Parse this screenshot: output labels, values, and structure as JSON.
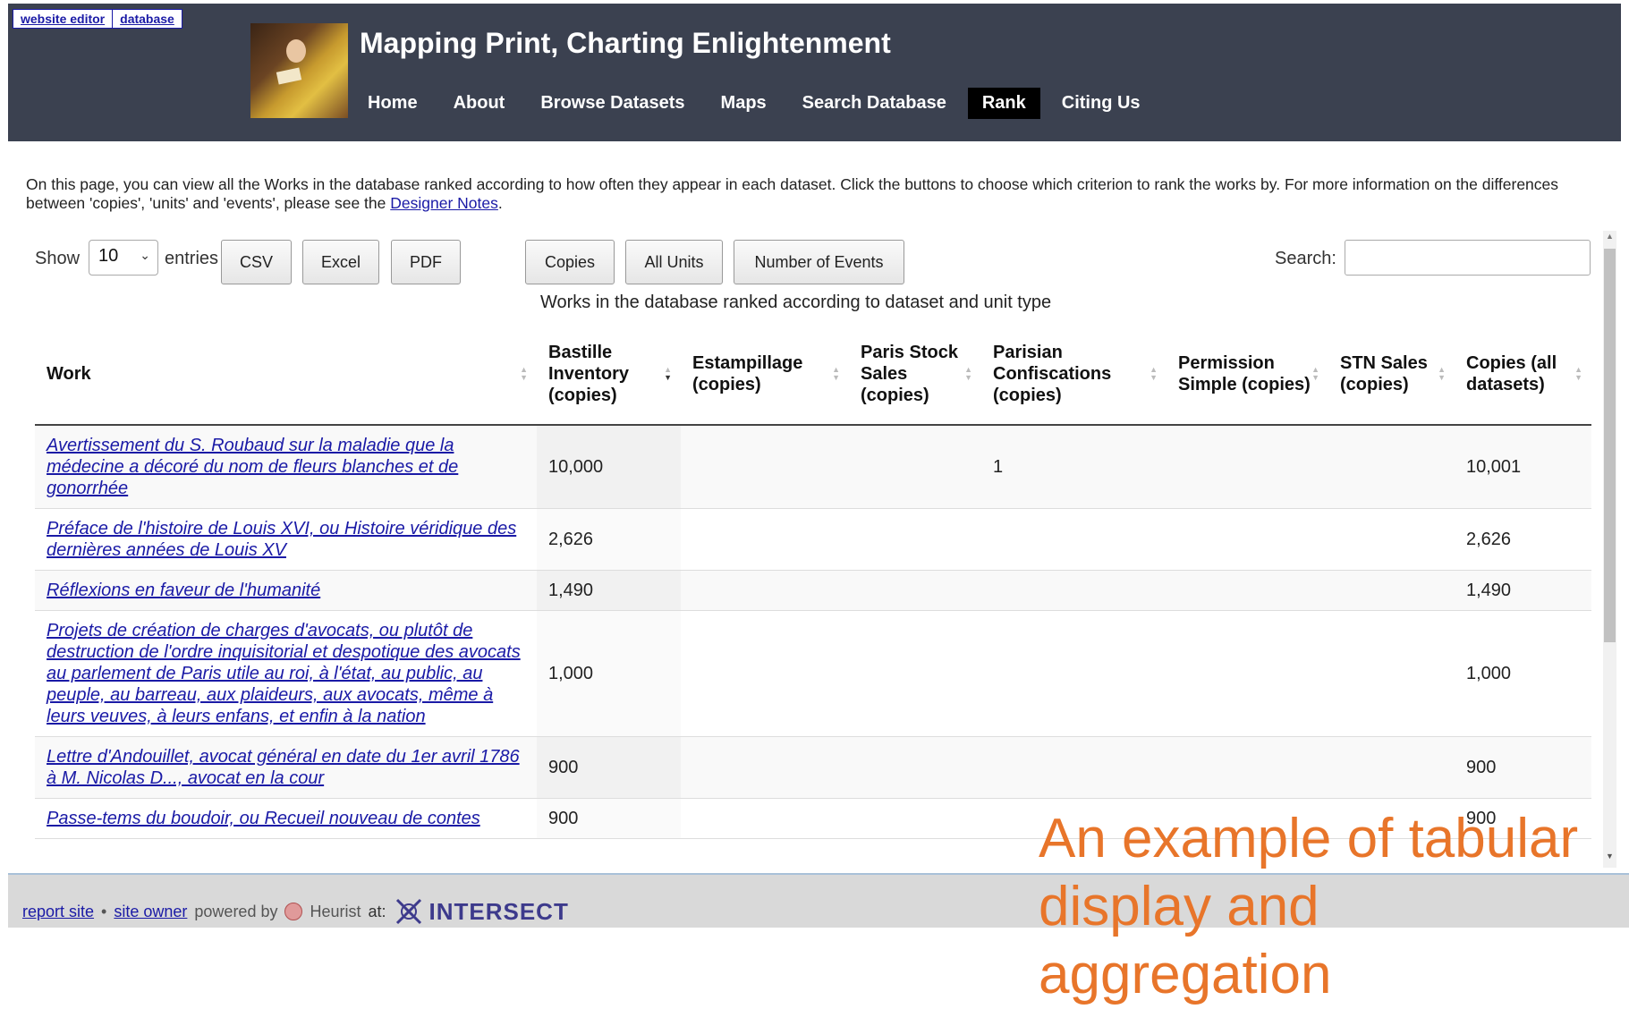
{
  "editor_links": [
    "website editor",
    "database"
  ],
  "site_title": "Mapping Print, Charting Enlightenment",
  "nav": [
    {
      "label": "Home",
      "active": false
    },
    {
      "label": "About",
      "active": false
    },
    {
      "label": "Browse Datasets",
      "active": false
    },
    {
      "label": "Maps",
      "active": false
    },
    {
      "label": "Search Database",
      "active": false
    },
    {
      "label": "Rank",
      "active": true
    },
    {
      "label": "Citing Us",
      "active": false
    }
  ],
  "intro": {
    "text": "On this page, you can view all the Works in the database ranked according to how often they appear in each dataset. Click the buttons to choose which criterion to rank the works by. For more information on the differences between 'copies', 'units' and 'events', please see the ",
    "link": "Designer Notes",
    "after": "."
  },
  "controls": {
    "show_label": "Show",
    "entries_value": "10",
    "entries_label": "entries",
    "export_buttons": [
      "CSV",
      "Excel",
      "PDF"
    ],
    "mode_buttons": [
      "Copies",
      "All Units",
      "Number of Events"
    ],
    "search_label": "Search:",
    "search_value": ""
  },
  "table": {
    "caption": "Works in the database ranked according to dataset and unit type",
    "columns": [
      "Work",
      "Bastille Inventory (copies)",
      "Estampillage (copies)",
      "Paris Stock Sales (copies)",
      "Parisian Confiscations (copies)",
      "Permission Simple (copies)",
      "STN Sales (copies)",
      "Copies (all datasets)"
    ],
    "rows": [
      {
        "work": "Avertissement du S. Roubaud sur la maladie que la médecine a décoré du nom de fleurs blanches et de gonorrhée",
        "bastille": "10,000",
        "estampillage": "",
        "paris_stock": "",
        "confiscations": "1",
        "permission": "",
        "stn": "",
        "total": "10,001"
      },
      {
        "work": "Préface de l'histoire de Louis XVI, ou Histoire véridique des dernières années de Louis XV",
        "bastille": "2,626",
        "estampillage": "",
        "paris_stock": "",
        "confiscations": "",
        "permission": "",
        "stn": "",
        "total": "2,626"
      },
      {
        "work": "Réflexions en faveur de l'humanité",
        "bastille": "1,490",
        "estampillage": "",
        "paris_stock": "",
        "confiscations": "",
        "permission": "",
        "stn": "",
        "total": "1,490"
      },
      {
        "work": "Projets de création de charges d'avocats, ou plutôt de destruction de l'ordre inquisitorial et despotique des avocats au parlement de Paris utile au roi, à l'état, au public, au peuple, au barreau, aux plaideurs, aux avocats, même à leurs veuves, à leurs enfans, et enfin à la nation",
        "bastille": "1,000",
        "estampillage": "",
        "paris_stock": "",
        "confiscations": "",
        "permission": "",
        "stn": "",
        "total": "1,000"
      },
      {
        "work": "Lettre d'Andouillet, avocat général en date du 1er avril 1786 à M. Nicolas D..., avocat en la cour",
        "bastille": "900",
        "estampillage": "",
        "paris_stock": "",
        "confiscations": "",
        "permission": "",
        "stn": "",
        "total": "900"
      },
      {
        "work": "Passe-tems du boudoir, ou Recueil nouveau de contes",
        "bastille": "900",
        "estampillage": "",
        "paris_stock": "",
        "confiscations": "",
        "permission": "",
        "stn": "",
        "total": "900"
      }
    ]
  },
  "footer": {
    "report": "report site",
    "sep": "•",
    "owner": "site owner",
    "powered": "powered by",
    "heurist": "Heurist",
    "at": "at:",
    "intersect": "INTERSECT"
  },
  "overlay_caption": "An example of tabular display and aggregation"
}
